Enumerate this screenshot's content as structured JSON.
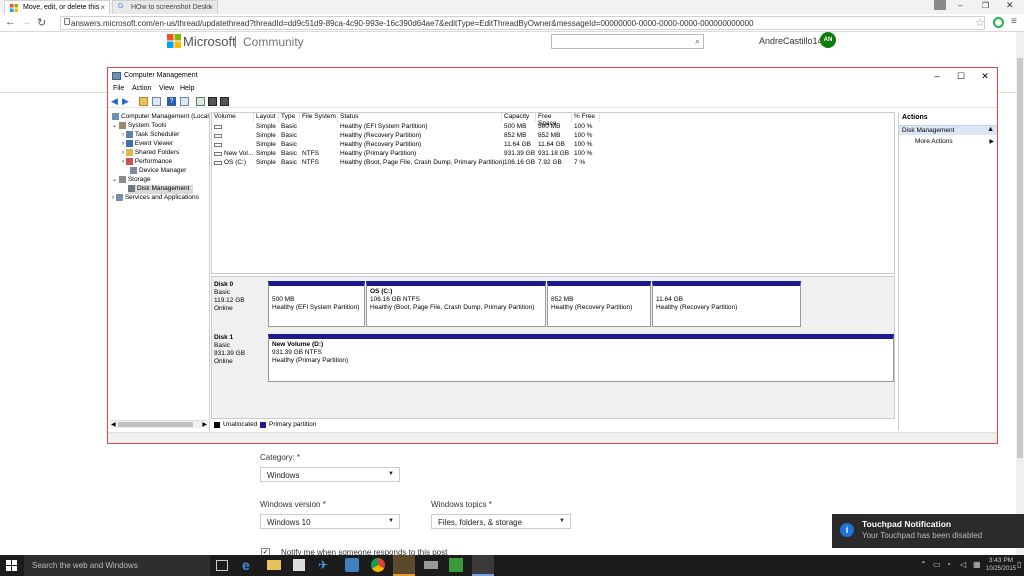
{
  "browser": {
    "tabs": [
      {
        "label": "Move, edit, or delete this"
      },
      {
        "label": "HOw to screenshot Deskt"
      }
    ],
    "url": "answers.microsoft.com/en-us/thread/updatethread?threadId=dd9c51d9-89ca-4c90-993e-16c390d64ae7&editType=EditThreadByOwner&messageId=00000000-0000-0000-0000-000000000000"
  },
  "site": {
    "brand": "Microsoft",
    "section": "Community",
    "user": "AndreCastillo14",
    "avatar_initials": "AN"
  },
  "window": {
    "title": "Computer Management",
    "menu": [
      "File",
      "Action",
      "View",
      "Help"
    ],
    "tree": [
      {
        "label": "Computer Management (Local",
        "level": 0
      },
      {
        "label": "System Tools",
        "level": 1
      },
      {
        "label": "Task Scheduler",
        "level": 2
      },
      {
        "label": "Event Viewer",
        "level": 2
      },
      {
        "label": "Shared Folders",
        "level": 2
      },
      {
        "label": "Performance",
        "level": 2
      },
      {
        "label": "Device Manager",
        "level": 2
      },
      {
        "label": "Storage",
        "level": 1
      },
      {
        "label": "Disk Management",
        "level": 2
      },
      {
        "label": "Services and Applications",
        "level": 1
      }
    ],
    "columns": [
      "Volume",
      "Layout",
      "Type",
      "File System",
      "Status",
      "Capacity",
      "Free Space",
      "% Free"
    ],
    "volumes": [
      [
        "",
        "Simple",
        "Basic",
        "",
        "Healthy (EFI System Partition)",
        "500 MB",
        "500 MB",
        "100 %"
      ],
      [
        "",
        "Simple",
        "Basic",
        "",
        "Healthy (Recovery Partition)",
        "852 MB",
        "852 MB",
        "100 %"
      ],
      [
        "",
        "Simple",
        "Basic",
        "",
        "Healthy (Recovery Partition)",
        "11.64 GB",
        "11.64 GB",
        "100 %"
      ],
      [
        "New Vol...",
        "Simple",
        "Basic",
        "NTFS",
        "Healthy (Primary Partition)",
        "931.39 GB",
        "931.18 GB",
        "100 %"
      ],
      [
        "OS (C:)",
        "Simple",
        "Basic",
        "NTFS",
        "Healthy (Boot, Page File, Crash Dump, Primary Partition)",
        "106.16 GB",
        "7.92 GB",
        "7 %"
      ]
    ],
    "disks": [
      {
        "name": "Disk 0",
        "type": "Basic",
        "size": "119.12 GB",
        "state": "Online",
        "partitions": [
          {
            "title": "",
            "size": "500 MB",
            "status": "Healthy (EFI System Partition)"
          },
          {
            "title": "OS  (C:)",
            "size": "106.16 GB NTFS",
            "status": "Healthy (Boot, Page File, Crash Dump, Primary Partition)"
          },
          {
            "title": "",
            "size": "852 MB",
            "status": "Healthy (Recovery Partition)"
          },
          {
            "title": "",
            "size": "11.64 GB",
            "status": "Healthy (Recovery Partition)"
          }
        ]
      },
      {
        "name": "Disk 1",
        "type": "Basic",
        "size": "931.39 GB",
        "state": "Online",
        "partitions": [
          {
            "title": "New Volume  (D:)",
            "size": "931.39 GB NTFS",
            "status": "Healthy (Primary Partition)"
          }
        ]
      }
    ],
    "legend": [
      "Unallocated",
      "Primary partition"
    ],
    "actions": {
      "header": "Actions",
      "section": "Disk Management",
      "items": [
        "More Actions"
      ]
    }
  },
  "form": {
    "category_label": "Category: *",
    "category_value": "Windows",
    "version_label": "Windows version *",
    "version_value": "Windows 10",
    "topics_label": "Windows topics *",
    "topics_value": "Files, folders, & storage",
    "notify_text": "Notify me when someone responds to this post"
  },
  "toast": {
    "title": "Touchpad Notification",
    "body": "Your Touchpad has been disabled"
  },
  "taskbar": {
    "search_placeholder": "Search the web and Windows",
    "time": "3:43 PM",
    "date": "10/25/2015"
  },
  "colors": {
    "partition_bar": "#1b1b8f",
    "window_border": "#e04848",
    "avatar": "#107c10"
  }
}
